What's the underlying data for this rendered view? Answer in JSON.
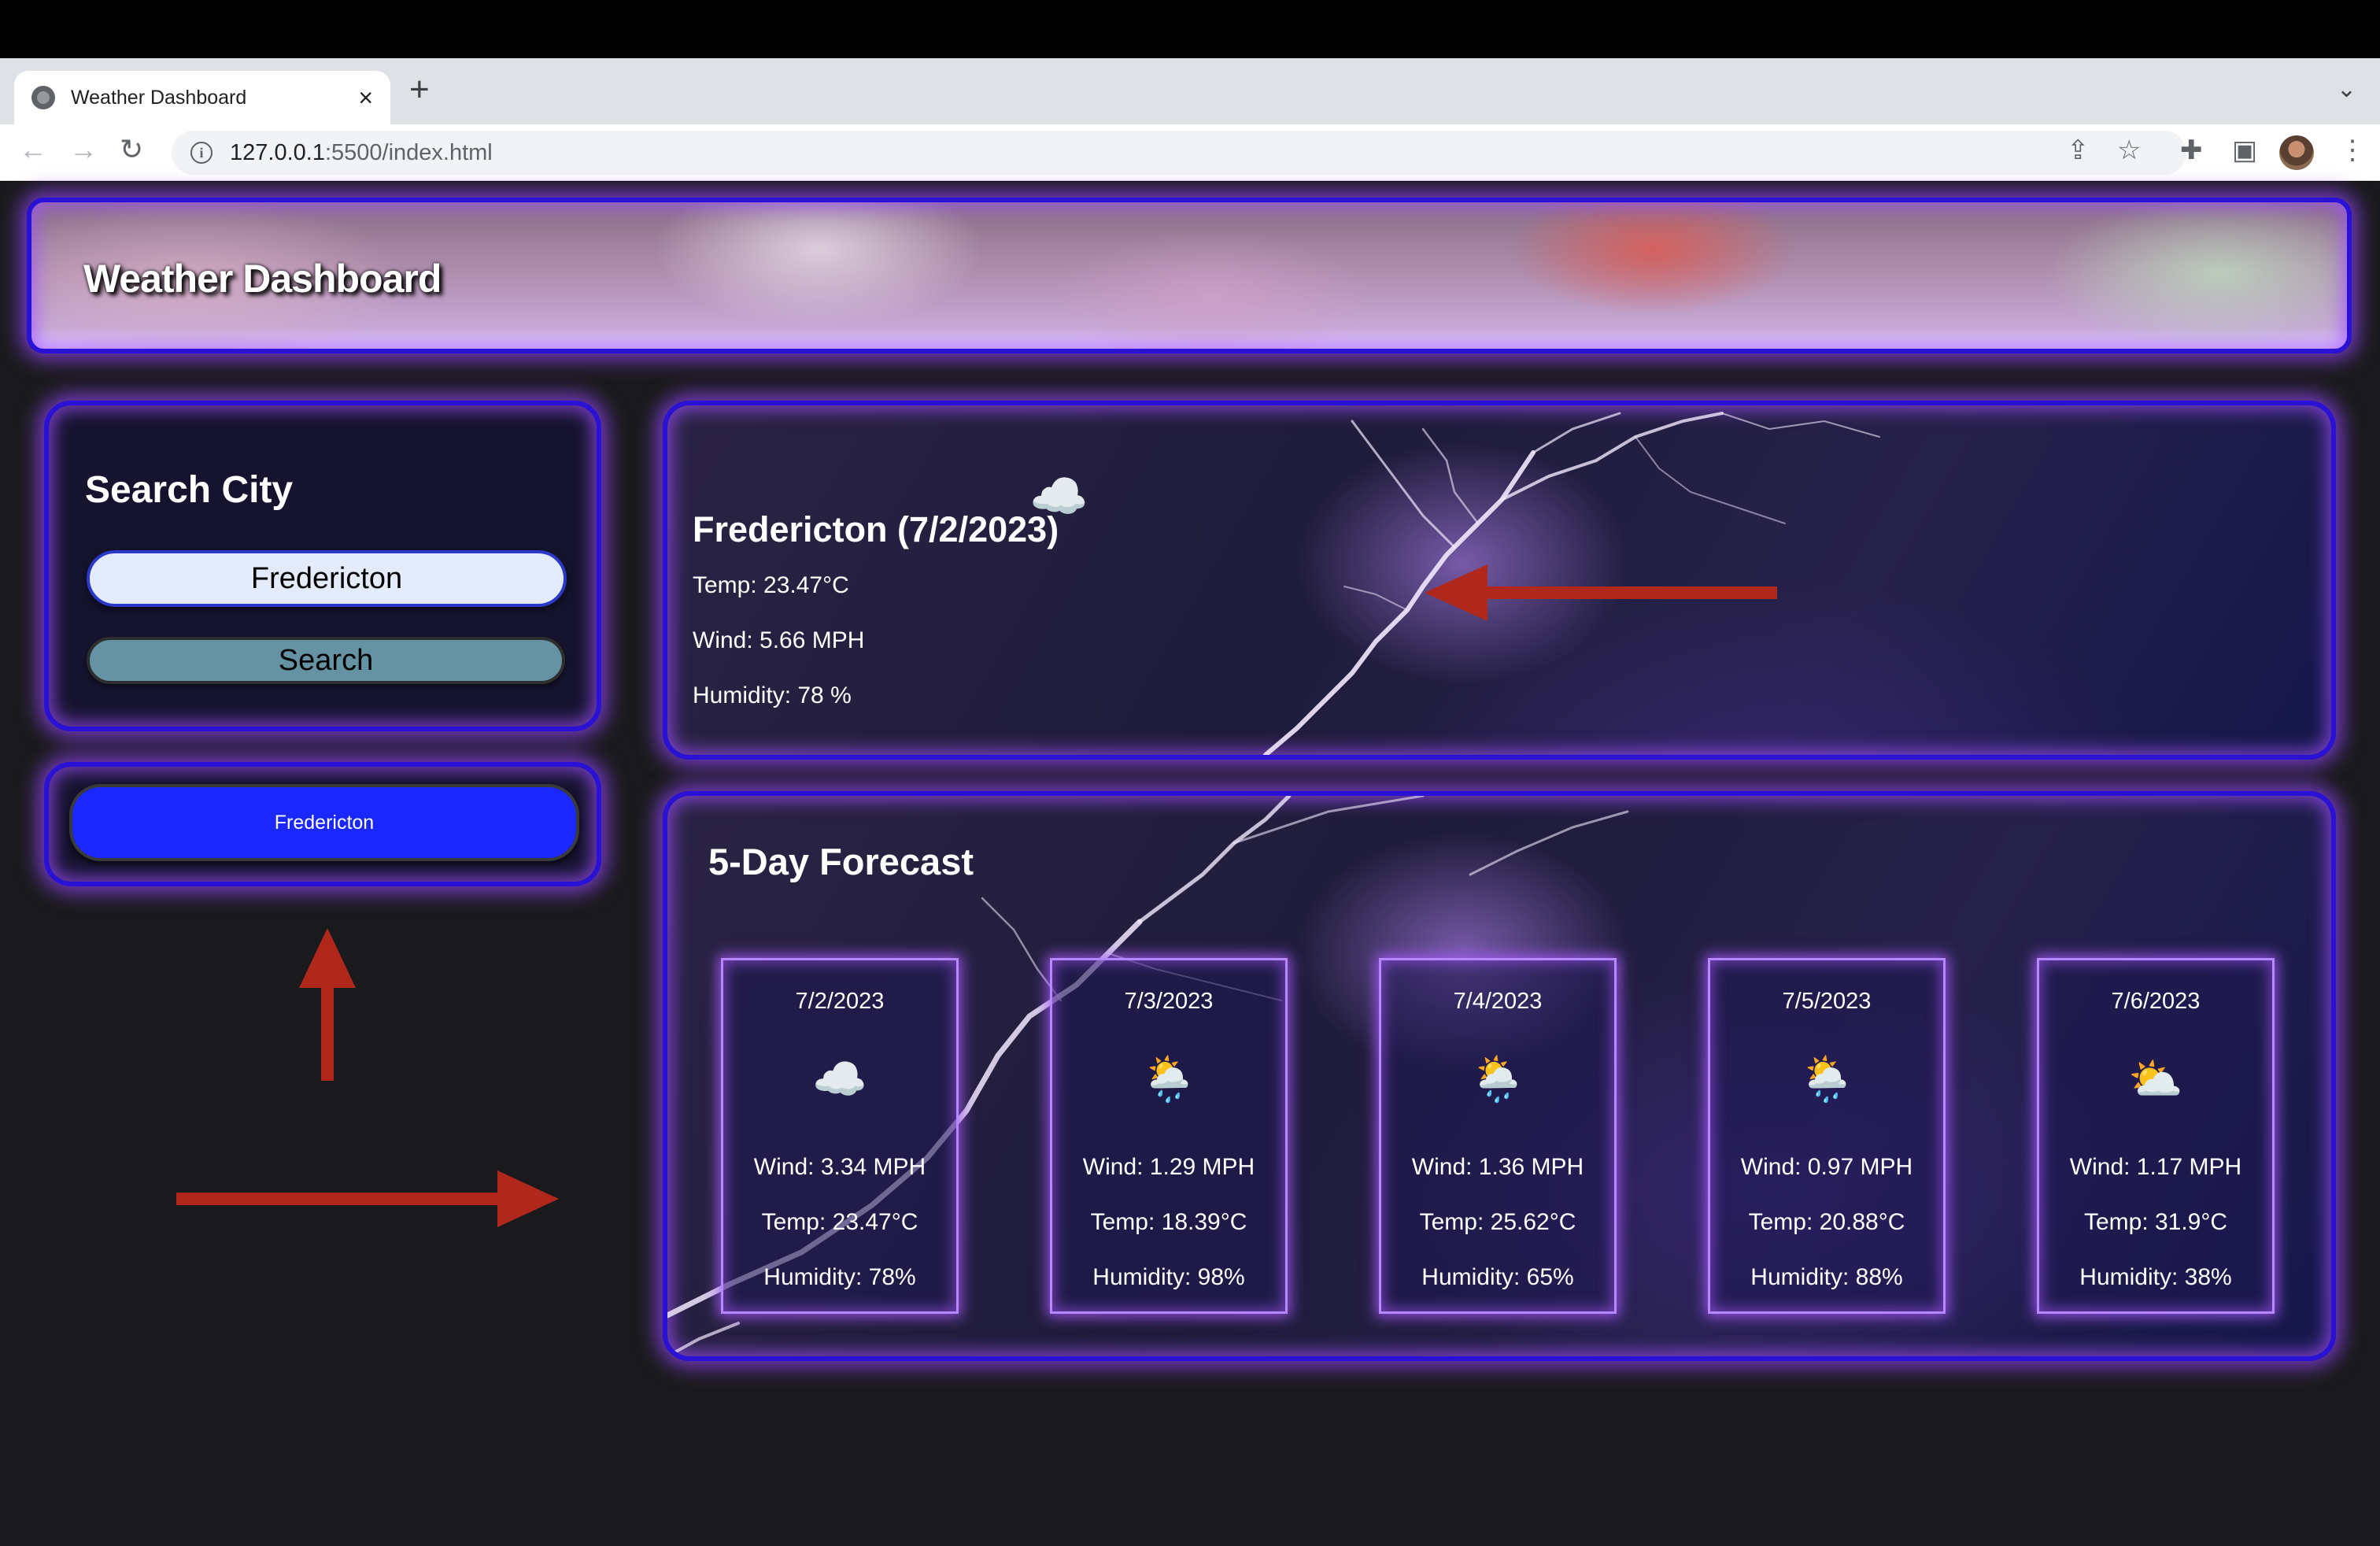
{
  "browser": {
    "tab_title": "Weather Dashboard",
    "url_host": "127.0.0.1",
    "url_path": ":5500/index.html"
  },
  "header": {
    "title": "Weather Dashboard"
  },
  "search": {
    "title": "Search City",
    "input_value": "Fredericton",
    "button_label": "Search"
  },
  "history": {
    "items": [
      "Fredericton"
    ]
  },
  "current": {
    "title": "Fredericton (7/2/2023)",
    "icon": "cloud-icon",
    "temp": "Temp: 23.47°C",
    "wind": "Wind: 5.66 MPH",
    "humidity": "Humidity: 78 %"
  },
  "forecast": {
    "title": "5-Day Forecast",
    "days": [
      {
        "date": "7/2/2023",
        "icon": "cloud-icon",
        "wind": "Wind: 3.34 MPH",
        "temp": "Temp: 23.47°C",
        "humidity": "Humidity: 78%"
      },
      {
        "date": "7/3/2023",
        "icon": "rain-sun-icon",
        "wind": "Wind: 1.29 MPH",
        "temp": "Temp: 18.39°C",
        "humidity": "Humidity: 98%"
      },
      {
        "date": "7/4/2023",
        "icon": "rain-sun-icon",
        "wind": "Wind: 1.36 MPH",
        "temp": "Temp: 25.62°C",
        "humidity": "Humidity: 65%"
      },
      {
        "date": "7/5/2023",
        "icon": "rain-sun-icon",
        "wind": "Wind: 0.97 MPH",
        "temp": "Temp: 20.88°C",
        "humidity": "Humidity: 88%"
      },
      {
        "date": "7/6/2023",
        "icon": "cloud-sun-icon",
        "wind": "Wind: 1.17 MPH",
        "temp": "Temp: 31.9°C",
        "humidity": "Humidity: 38%"
      }
    ]
  },
  "colors": {
    "panel_border": "#2a11d6",
    "glow": "#9646ff",
    "history_button": "#1a28ff",
    "search_button": "#6593a4",
    "annotation_arrow": "#b0281c"
  }
}
